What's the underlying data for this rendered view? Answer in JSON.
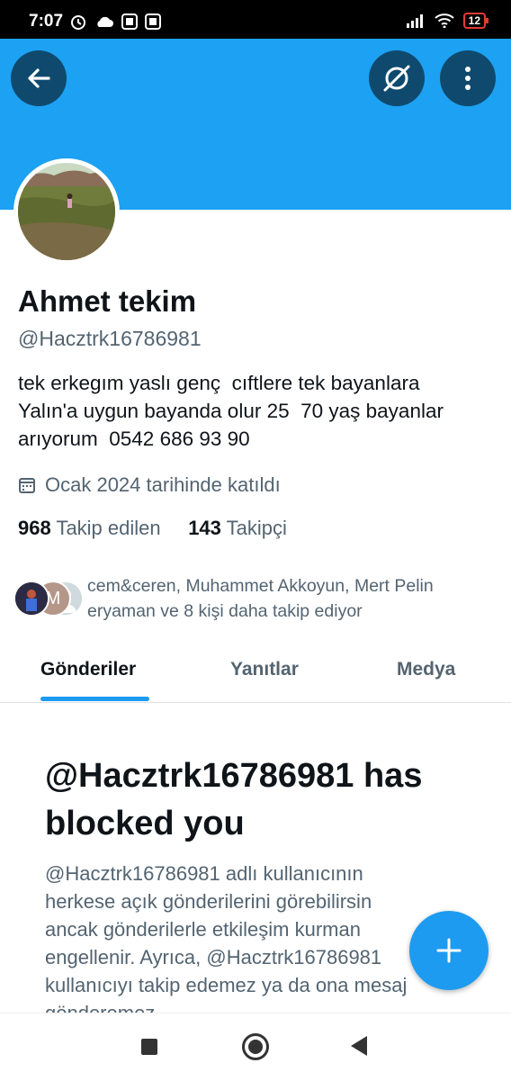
{
  "status_bar": {
    "time": "7:07",
    "battery": "12"
  },
  "profile": {
    "name": "Ahmet tekim",
    "handle": "@Hacztrk16786981",
    "bio_lines": [
      "tek erkegım yaslı genç  cıftlere tek bayanlara",
      "Yalın'a uygun bayanda olur 25  70 yaş bayanlar",
      "arıyorum  0542 686 93 90"
    ],
    "joined": "Ocak 2024 tarihinde katıldı",
    "following_count": "968",
    "following_label": "Takip edilen",
    "followers_count": "143",
    "followers_label": "Takipçi",
    "known_followers_lines": [
      "cem&ceren, Muhammet Akkoyun, Mert Pelin",
      "eryaman ve 8 kişi daha takip ediyor"
    ],
    "mini_avatar_letter": "M"
  },
  "tabs": [
    {
      "label": "Gönderiler",
      "active": true
    },
    {
      "label": "Yanıtlar",
      "active": false
    },
    {
      "label": "Medya",
      "active": false
    }
  ],
  "blocked": {
    "title_lines": [
      "@Hacztrk16786981 has",
      "blocked you"
    ],
    "body_lines": [
      "@Hacztrk16786981 adlı kullanıcının",
      "herkese açık gönderilerini görebilirsin",
      "ancak gönderilerle etkileşim kurman",
      "engellenir. Ayrıca, @Hacztrk16786981",
      "kullanıcıyı takip edemez ya da ona mesaj",
      "gönderemez."
    ]
  },
  "icons": {
    "back": "arrow-left-icon",
    "norepost": "retweets-off-icon",
    "more": "more-vertical-icon",
    "fab": "plus-icon",
    "calendar": "calendar-icon"
  },
  "colors": {
    "banner": "#1da1f2",
    "accent": "#1d9bf0",
    "secondary_text": "#536471"
  }
}
